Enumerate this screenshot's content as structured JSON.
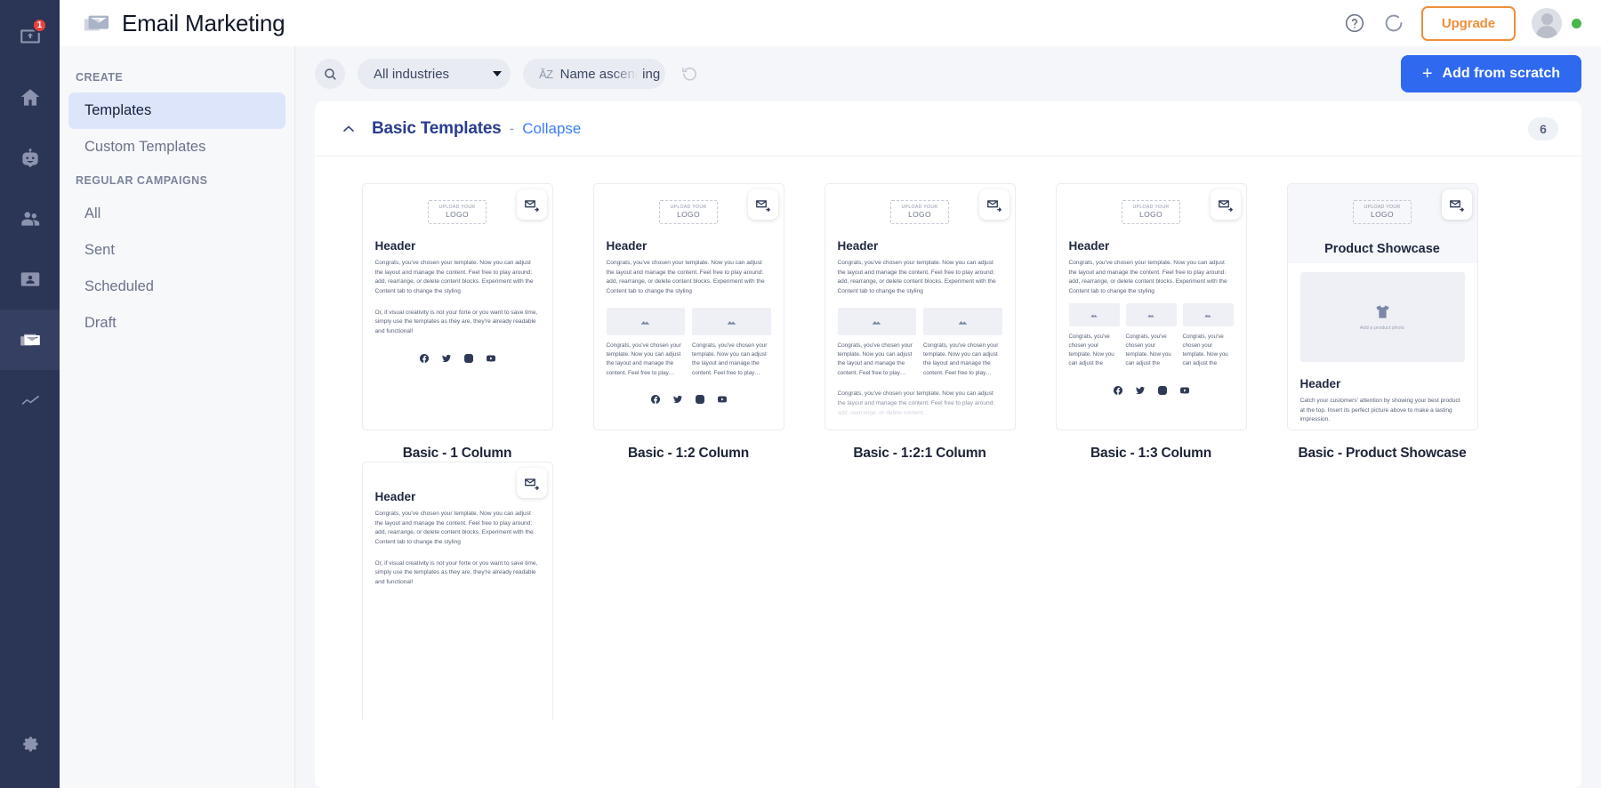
{
  "rail": {
    "items": [
      {
        "name": "inbox",
        "badge": "1"
      },
      {
        "name": "home",
        "badge": ""
      },
      {
        "name": "chatbot",
        "badge": ""
      },
      {
        "name": "contacts",
        "badge": ""
      },
      {
        "name": "crm-card",
        "badge": ""
      },
      {
        "name": "email",
        "badge": ""
      },
      {
        "name": "analytics",
        "badge": ""
      }
    ],
    "settings_icon": "gear-icon"
  },
  "header": {
    "title": "Email Marketing",
    "logo_icon": "envelope-icon",
    "help_icon": "question-circle-icon",
    "refresh_icon": "spinner-icon",
    "upgrade_label": "Upgrade",
    "avatar_icon": "avatar",
    "status_dot_color": "#49b649",
    "accent_orange": "#ef8e3a"
  },
  "sidebar": {
    "groups": [
      {
        "title": "CREATE",
        "items": [
          {
            "label": "Templates",
            "active": true
          },
          {
            "label": "Custom Templates",
            "active": false
          }
        ]
      },
      {
        "title": "REGULAR CAMPAIGNS",
        "items": [
          {
            "label": "All",
            "active": false
          },
          {
            "label": "Sent",
            "active": false
          },
          {
            "label": "Scheduled",
            "active": false
          },
          {
            "label": "Draft",
            "active": false
          }
        ]
      }
    ]
  },
  "toolbar": {
    "search_icon": "search-icon",
    "industries_filter": "All industries",
    "sort_filter": "Name ascending",
    "sort_icon": "az-sort-icon",
    "reset_icon": "reset-icon",
    "add_button": "Add from scratch",
    "add_icon": "plus-icon",
    "add_button_color": "#2f69f0"
  },
  "section": {
    "title": "Basic Templates",
    "separator": "-",
    "collapse_label": "Collapse",
    "count": "6",
    "chevron_icon": "chevron-up-icon"
  },
  "templates": {
    "logo_placeholder_line1": "UPLOAD YOUR",
    "logo_placeholder_line2": "LOGO",
    "send_icon": "send-email-icon",
    "image_icon": "image-placeholder-icon",
    "product_photo_caption": "Add a product photo",
    "product_icon": "tshirt-icon",
    "socials": [
      "facebook-icon",
      "twitter-icon",
      "instagram-icon",
      "youtube-icon"
    ],
    "body_main": "Congrats, you've chosen your template. Now you can adjust the layout and manage the content. Feel free to play around: add, rearrange, or delete content blocks. Experiment with the Content tab to change the styling",
    "body_second": "Or, if visual creativity is not your forte or you want to save time, simply use the templates as they are, they're already readable and functional!",
    "body_col2": "Congrats, you've chosen your template. Now you can adjust the layout and manage the content. Feel free to play…",
    "body_col3": "Congrats, you've chosen your template. Now you can adjust the",
    "body_faded": "Congrats, you've chosen your template. Now you can adjust the layout and manage the content. Feel free to play around: add, rearrange, or delete content…",
    "header_text": "Header",
    "showcase_title": "Product Showcase",
    "showcase_body": "Catch your customers' attention by showing your best product at the top. Insert its perfect picture above to make a lasting impression.",
    "cards": [
      {
        "label": "Basic - 1 Column"
      },
      {
        "label": "Basic - 1:2 Column"
      },
      {
        "label": "Basic - 1:2:1 Column"
      },
      {
        "label": "Basic - 1:3 Column"
      },
      {
        "label": "Basic - Product Showcase"
      },
      {
        "label": ""
      }
    ]
  }
}
